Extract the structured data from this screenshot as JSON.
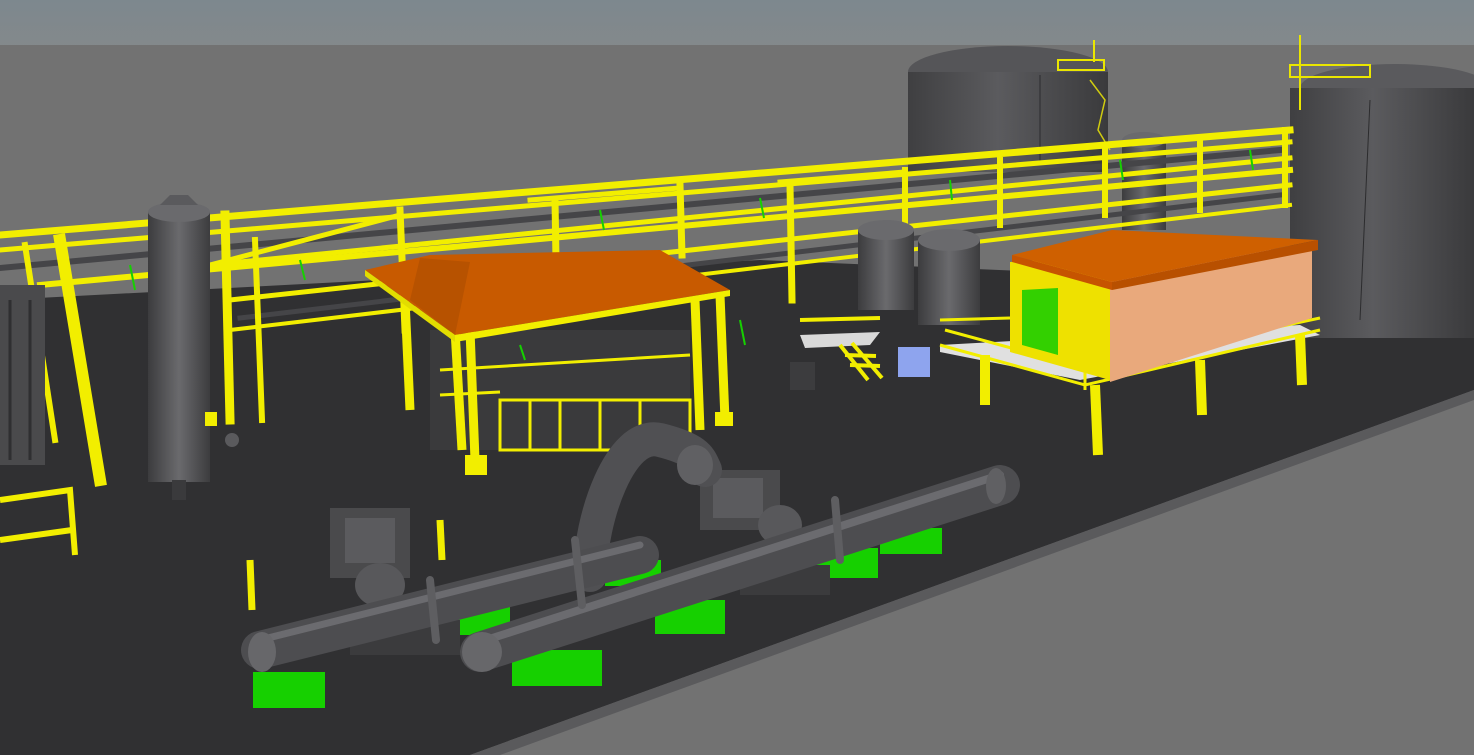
{
  "viewport": {
    "kind": "3d-plant-model",
    "colors": {
      "sky": "#7f8a90",
      "ground": "#6f6f6f",
      "pad": "#2f2f31",
      "steel": "#f2ee00",
      "steel_dark": "#b6b000",
      "equipment": "#4b4b4d",
      "equipment_light": "#6a6a6d",
      "supports": "#16d000",
      "roof": "#c95a00",
      "building_wall": "#e8a87a",
      "door": "#33d000",
      "box": "#8ea4ee"
    }
  }
}
